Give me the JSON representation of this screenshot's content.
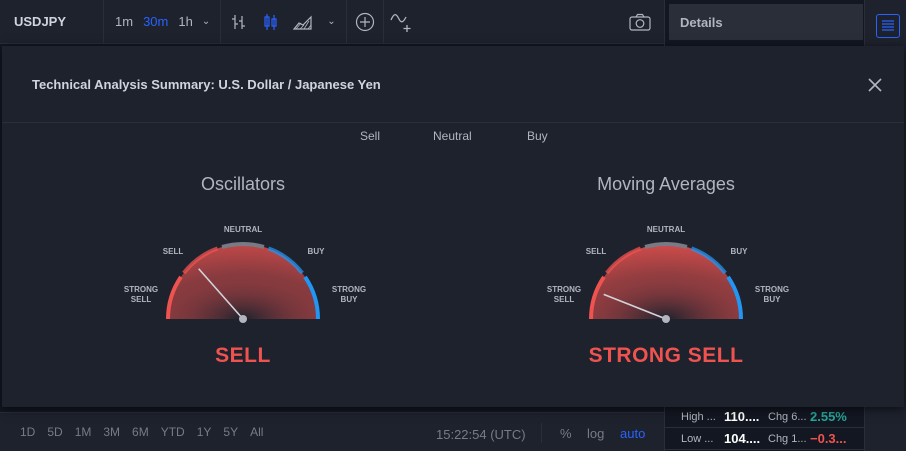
{
  "toolbar": {
    "symbol": "USDJPY",
    "intervals": [
      "1m",
      "30m",
      "1h"
    ],
    "active_interval": "30m",
    "tools": [
      "bar-style-icon",
      "candles-icon",
      "area-chart-icon",
      "add-compare-icon",
      "indicators-icon"
    ],
    "camera_icon": "camera-icon"
  },
  "right_panel": {
    "details_label": "Details",
    "menu_icon": "list-icon",
    "stats": [
      {
        "label": "High ...",
        "value": "110....",
        "chg_label": "Chg 6...",
        "chg": "2.55%",
        "chg_color": "#26a69a"
      },
      {
        "label": "Low ...",
        "value": "104....",
        "chg_label": "Chg 1...",
        "chg": "−0.3...",
        "chg_color": "#ef5350"
      }
    ]
  },
  "bottom": {
    "ranges": [
      "1D",
      "5D",
      "1M",
      "3M",
      "6M",
      "YTD",
      "1Y",
      "5Y",
      "All"
    ],
    "time": "15:22:54 (UTC)",
    "percent": "%",
    "log": "log",
    "auto": "auto"
  },
  "dialog": {
    "title": "Technical Analysis Summary: U.S. Dollar / Japanese Yen",
    "tabs": [
      "Sell",
      "Neutral",
      "Buy"
    ],
    "gauges": [
      {
        "title": "Oscillators",
        "result": "SELL",
        "needle_value": 0.27,
        "labels": {
          "strong_sell": [
            "STRONG",
            "SELL"
          ],
          "sell": "SELL",
          "neutral": "NEUTRAL",
          "buy": "BUY",
          "strong_buy": [
            "STRONG",
            "BUY"
          ]
        }
      },
      {
        "title": "Moving Averages",
        "result": "STRONG SELL",
        "needle_value": 0.12,
        "labels": {
          "strong_sell": [
            "STRONG",
            "SELL"
          ],
          "sell": "SELL",
          "neutral": "NEUTRAL",
          "buy": "BUY",
          "strong_buy": [
            "STRONG",
            "BUY"
          ]
        }
      }
    ],
    "colors": {
      "sell": "#ef5350",
      "neutral": "#787b86",
      "buy": "#2196f3"
    }
  }
}
